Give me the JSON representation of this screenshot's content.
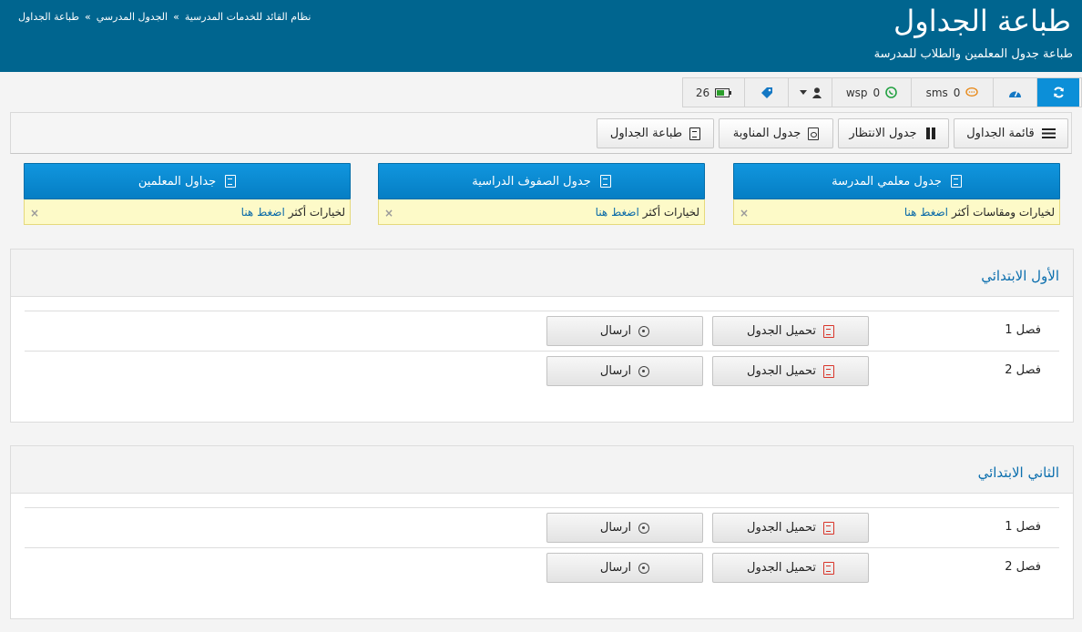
{
  "header": {
    "title": "طباعة الجداول",
    "subtitle": "طباعة جدول المعلمين والطلاب للمدرسة",
    "breadcrumb": [
      "نظام القائد للخدمات المدرسية",
      "الجدول المدرسي",
      "طباعة الجداول"
    ],
    "breadcrumb_sep": "»"
  },
  "toolbar": {
    "battery_count": "26",
    "wsp_label": "wsp",
    "wsp_count": "0",
    "sms_label": "sms",
    "sms_count": "0",
    "colors": {
      "refresh": "#0c8fd8",
      "battery": "#2a9d2a",
      "whatsapp": "#25a244",
      "sms": "#e88a1a",
      "accent": "#0c6fae"
    }
  },
  "tabs": [
    {
      "label": "قائمة الجداول",
      "icon": "list-icon"
    },
    {
      "label": "جدول الانتظار",
      "icon": "pause-icon"
    },
    {
      "label": "جدول المناوبة",
      "icon": "shield-doc-icon"
    },
    {
      "label": "طباعة الجداول",
      "icon": "pdf-icon"
    }
  ],
  "cards": [
    {
      "button": "جدول معلمي المدرسة",
      "note": "لخيارات ومقاسات أكثر",
      "link": "اضغط هنا",
      "close": "×"
    },
    {
      "button": "جدول الصفوف الدراسية",
      "note": "لخيارات أكثر",
      "link": "اضغط هنا",
      "close": "×"
    },
    {
      "button": "جداول المعلمين",
      "note": "لخيارات أكثر",
      "link": "اضغط هنا",
      "close": "×"
    }
  ],
  "sections": [
    {
      "title": "الأول الابتدائي",
      "rows": [
        {
          "label": "فصل 1",
          "download": "تحميل الجدول",
          "send": "ارسال"
        },
        {
          "label": "فصل 2",
          "download": "تحميل الجدول",
          "send": "ارسال"
        }
      ]
    },
    {
      "title": "الثاني الابتدائي",
      "rows": [
        {
          "label": "فصل 1",
          "download": "تحميل الجدول",
          "send": "ارسال"
        },
        {
          "label": "فصل 2",
          "download": "تحميل الجدول",
          "send": "ارسال"
        }
      ]
    }
  ]
}
